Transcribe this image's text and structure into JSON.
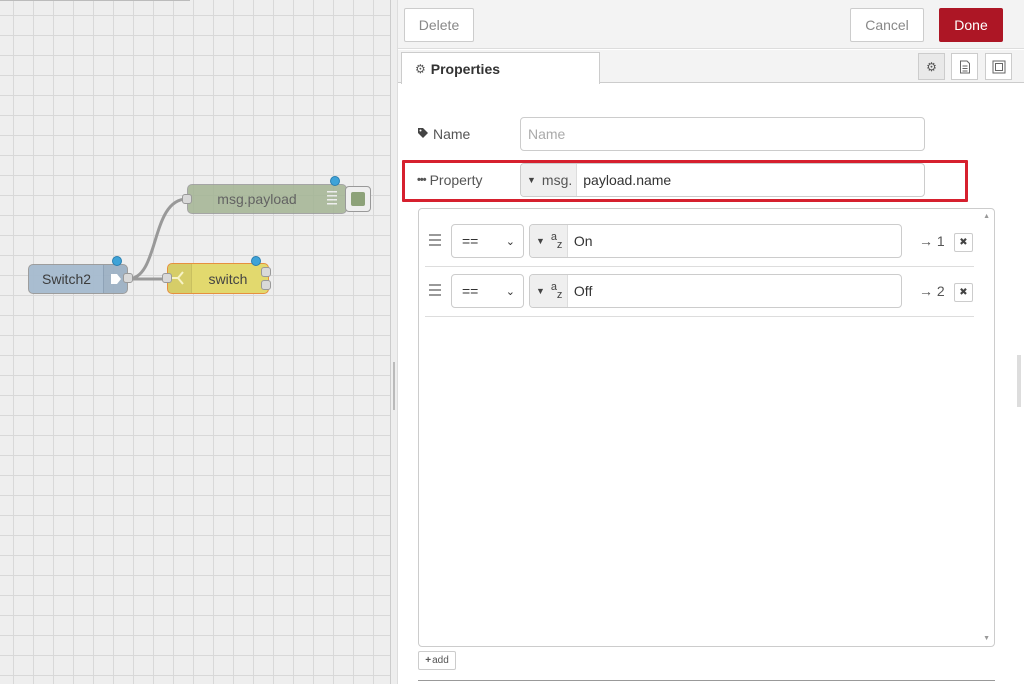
{
  "canvas": {
    "nodes": {
      "inject_label": "Switch2",
      "debug_label": "msg.payload",
      "switch_label": "switch"
    }
  },
  "tray": {
    "header": {
      "delete_label": "Delete",
      "cancel_label": "Cancel",
      "done_label": "Done"
    },
    "tabs": {
      "properties_label": "Properties"
    },
    "form": {
      "name_label": "Name",
      "name_placeholder": "Name",
      "name_value": "",
      "property_label": "Property",
      "property_type": "msg.",
      "property_value": "payload.name"
    },
    "rules": [
      {
        "operator": "==",
        "value": "On",
        "port": "→ 1"
      },
      {
        "operator": "==",
        "value": "Off",
        "port": "→ 2"
      }
    ],
    "add_label": "add"
  },
  "colors": {
    "done_button": "#ad1625",
    "highlight_box": "#d6202e",
    "inject_node": "#a6bbcf",
    "debug_node": "#a3b493",
    "switch_node": "#e2d96e"
  },
  "icons": [
    "gear-icon",
    "tag-icon",
    "ellipsis-icon",
    "info-icon",
    "frame-icon",
    "drag-handle-icon",
    "remove-icon",
    "plus-icon",
    "string-type-icon",
    "caret-down-icon"
  ]
}
